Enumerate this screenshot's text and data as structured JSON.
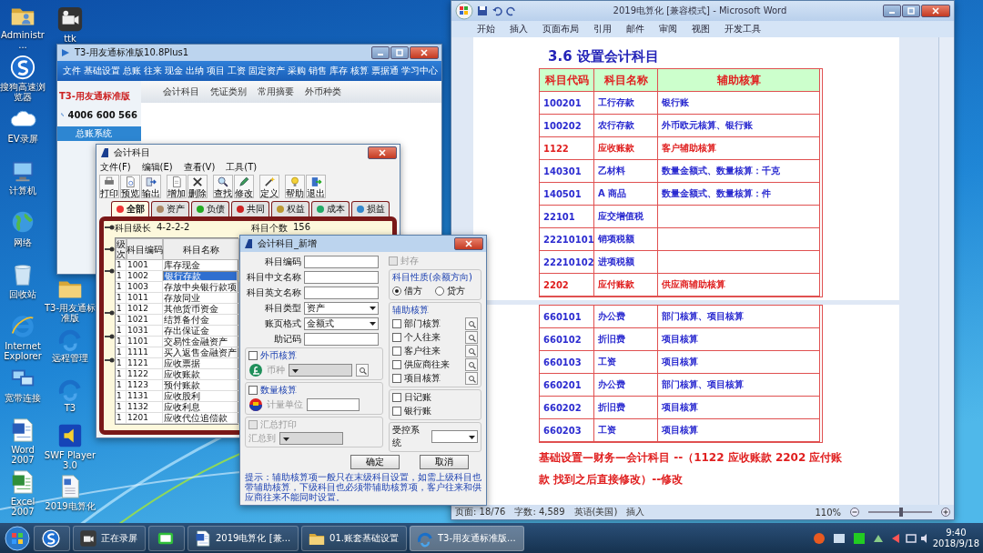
{
  "desktop": {
    "column_1": [
      {
        "kind": "user-folder",
        "label": "Administr..."
      },
      {
        "kind": "circle-app",
        "label": "搜狗高速浏览器"
      },
      {
        "kind": "cloud",
        "label": "EV录屏"
      },
      {
        "kind": "computer",
        "label": "计算机"
      },
      {
        "kind": "globe",
        "label": "网络"
      },
      {
        "kind": "trash",
        "label": "回收站"
      },
      {
        "kind": "browser",
        "label": "Internet Explorer"
      },
      {
        "kind": "monitor",
        "label": "宽带连接"
      },
      {
        "kind": "document",
        "label": "Word 2007"
      },
      {
        "kind": "spreadsheet",
        "label": "Excel 2007"
      }
    ],
    "column_2": [
      {
        "kind": "camera",
        "label": "ttk"
      },
      {
        "kind": "folder",
        "label": "T3-用友通标准版"
      },
      {
        "kind": "swirl",
        "label": "远程管理"
      },
      {
        "kind": "swirl",
        "label": "T3"
      },
      {
        "kind": "speaker",
        "label": "SWF Player 3.0"
      },
      {
        "kind": "file",
        "label": "2019电算化"
      }
    ]
  },
  "t3_window": {
    "title": "T3-用友通标准版10.8Plus1",
    "menu": [
      "文件",
      "基础设置",
      "总账",
      "往来",
      "现金",
      "出纳",
      "项目",
      "工资",
      "固定资产",
      "采购",
      "销售",
      "库存",
      "核算",
      "票据通",
      "学习中心"
    ],
    "logo": "T3-用友通标准版",
    "phone": "4006 600 566",
    "nav": [
      {
        "label": "总账系统",
        "selected": true
      }
    ],
    "toolbar_links": [
      "会计科目",
      "凭证类别",
      "常用摘要",
      "外币种类"
    ]
  },
  "accounts_window": {
    "title": "会计科目",
    "menu": [
      "文件(F)",
      "编辑(E)",
      "查看(V)",
      "工具(T)"
    ],
    "toolbar": [
      {
        "kind": "print",
        "label": "打印"
      },
      {
        "kind": "preview",
        "label": "预览"
      },
      {
        "kind": "export",
        "label": "输出"
      },
      {
        "kind": "add",
        "label": "增加"
      },
      {
        "kind": "delete",
        "label": "删除"
      },
      {
        "kind": "find",
        "label": "查找"
      },
      {
        "kind": "edit",
        "label": "修改"
      },
      {
        "kind": "define",
        "label": "定义"
      },
      {
        "kind": "help",
        "label": "帮助"
      },
      {
        "kind": "exit",
        "label": "退出"
      }
    ],
    "tabs": [
      {
        "label": "全部",
        "selected": true
      },
      {
        "label": "资产",
        "selected": false
      },
      {
        "label": "负债",
        "selected": false
      },
      {
        "label": "共同",
        "selected": false
      },
      {
        "label": "权益",
        "selected": false
      },
      {
        "label": "成本",
        "selected": false
      },
      {
        "label": "损益",
        "selected": false
      }
    ],
    "level_label": "科目级长",
    "level_value": "4-2-2-2",
    "count_label": "科目个数",
    "count_value": "156",
    "columns": [
      "级次",
      "科目编码",
      "科目名称"
    ],
    "rows": [
      {
        "level": "1",
        "code": "1001",
        "name": "库存现金",
        "selected": false
      },
      {
        "level": "1",
        "code": "1002",
        "name": "银行存款",
        "selected": true
      },
      {
        "level": "1",
        "code": "1003",
        "name": "存放中央银行款项",
        "selected": false
      },
      {
        "level": "1",
        "code": "1011",
        "name": "存放同业",
        "selected": false
      },
      {
        "level": "1",
        "code": "1012",
        "name": "其他货币资金",
        "selected": false
      },
      {
        "level": "1",
        "code": "1021",
        "name": "结算备付金",
        "selected": false
      },
      {
        "level": "1",
        "code": "1031",
        "name": "存出保证金",
        "selected": false
      },
      {
        "level": "1",
        "code": "1101",
        "name": "交易性金融资产",
        "selected": false
      },
      {
        "level": "1",
        "code": "1111",
        "name": "买入返售金融资产",
        "selected": false
      },
      {
        "level": "1",
        "code": "1121",
        "name": "应收票据",
        "selected": false
      },
      {
        "level": "1",
        "code": "1122",
        "name": "应收账款",
        "selected": false
      },
      {
        "level": "1",
        "code": "1123",
        "name": "预付账款",
        "selected": false
      },
      {
        "level": "1",
        "code": "1131",
        "name": "应收股利",
        "selected": false
      },
      {
        "level": "1",
        "code": "1132",
        "name": "应收利息",
        "selected": false
      },
      {
        "level": "1",
        "code": "1201",
        "name": "应收代位追偿款",
        "selected": false
      }
    ]
  },
  "new_account_dialog": {
    "title": "会计科目_新增",
    "fields": [
      {
        "label": "科目编码",
        "kind": "text"
      },
      {
        "label": "科目中文名称",
        "kind": "text"
      },
      {
        "label": "科目英文名称",
        "kind": "text"
      },
      {
        "label": "科目类型",
        "kind": "select",
        "value": "资产"
      },
      {
        "label": "账页格式",
        "kind": "select",
        "value": "金额式"
      },
      {
        "label": "助记码",
        "kind": "text"
      }
    ],
    "sealed": {
      "label": "封存",
      "checked": false,
      "disabled": true
    },
    "foreign_currency": {
      "label": "外币核算",
      "checked": false,
      "disabled": false,
      "field_label": "币种"
    },
    "quantity": {
      "label": "数量核算",
      "checked": false,
      "disabled": false,
      "field_label": "计量单位"
    },
    "summary_print": {
      "label": "汇总打印",
      "checked": false,
      "disabled": true,
      "field_label": "汇总到"
    },
    "balance_direction": {
      "title": "科目性质(余额方向)",
      "options": [
        {
          "label": "借方",
          "selected": true
        },
        {
          "label": "贷方",
          "selected": false
        }
      ]
    },
    "auxiliary": {
      "title": "辅助核算",
      "items": [
        {
          "label": "部门核算",
          "checked": false
        },
        {
          "label": "个人往来",
          "checked": false
        },
        {
          "label": "客户往来",
          "checked": false
        },
        {
          "label": "供应商往来",
          "checked": false
        },
        {
          "label": "项目核算",
          "checked": false
        }
      ]
    },
    "journals": [
      {
        "label": "日记账",
        "checked": false
      },
      {
        "label": "银行账",
        "checked": false
      }
    ],
    "controlled_system": {
      "label": "受控系统"
    },
    "buttons": [
      "确定",
      "取消"
    ],
    "hint": "提示：辅助核算项一般只在末级科目设置，如需上级科目也带辅助核算，下级科目也必须带辅助核算项，客户往来和供应商往来不能同时设置。"
  },
  "word_window": {
    "title": "2019电算化 [兼容模式] - Microsoft Word",
    "ribbon_tabs": [
      "开始",
      "插入",
      "页面布局",
      "引用",
      "邮件",
      "审阅",
      "视图",
      "开发工具"
    ],
    "heading": "3.6 设置会计科目",
    "table": {
      "columns": [
        "科目代码",
        "科目名称",
        "辅助核算"
      ],
      "rows": [
        {
          "code": "100201",
          "name": "工行存款",
          "auxiliary": "银行账",
          "color": "#2b2bd0"
        },
        {
          "code": "100202",
          "name": "农行存款",
          "auxiliary": "外币欧元核算、银行账",
          "color": "#2b2bd0"
        },
        {
          "code": "1122",
          "name": "应收账款",
          "auxiliary": "客户辅助核算",
          "color": "#e02020"
        },
        {
          "code": "140301",
          "name": "乙材料",
          "auxiliary": "数量金额式、数量核算：千克",
          "color": "#2b2bd0"
        },
        {
          "code": "140501",
          "name": "A 商品",
          "auxiliary": "数量金额式、数量核算：件",
          "color": "#2b2bd0"
        },
        {
          "code": "22101",
          "name": "应交增值税",
          "color": "#2b2bd0"
        },
        {
          "code": "22210101",
          "name": "销项税额",
          "color": "#2b2bd0"
        },
        {
          "code": "22210102",
          "name": "进项税额",
          "color": "#2b2bd0"
        },
        {
          "code": "2202",
          "name": "应付账款",
          "auxiliary": "供应商辅助核算",
          "color": "#e02020"
        }
      ]
    },
    "table_continued": {
      "rows": [
        {
          "code": "660101",
          "name": "办公费",
          "auxiliary": "部门核算、项目核算",
          "color": "#2b2bd0"
        },
        {
          "code": "660102",
          "name": "折旧费",
          "auxiliary": "项目核算",
          "color": "#2b2bd0"
        },
        {
          "code": "660103",
          "name": "工资",
          "auxiliary": "项目核算",
          "color": "#2b2bd0"
        },
        {
          "code": "660201",
          "name": "办公费",
          "auxiliary": "部门核算、项目核算",
          "color": "#2b2bd0"
        },
        {
          "code": "660202",
          "name": "折旧费",
          "auxiliary": "项目核算",
          "color": "#2b2bd0"
        },
        {
          "code": "660203",
          "name": "工资",
          "auxiliary": "项目核算",
          "color": "#2b2bd0"
        }
      ]
    },
    "note": "基础设置—财务—会计科目 --（1122 应收账款 2202 应付账款 找到之后直接修改）--修改",
    "status_bar": {
      "page": "页面: 18/76",
      "words": "字数: 4,589",
      "language": "英语(美国)",
      "mode": "插入",
      "zoom": "110%",
      "zoom_slider": {
        "level": 0.52
      }
    }
  },
  "taskbar": {
    "items": [
      {
        "kind": "recorder",
        "label": "正在录屏",
        "selected": false
      },
      {
        "kind": "tv",
        "selected": false
      },
      {
        "kind": "document",
        "label": "2019电算化 [兼...",
        "selected": false
      },
      {
        "kind": "folder",
        "label": "01.账套基础设置",
        "selected": false
      },
      {
        "kind": "swirl",
        "label": "T3-用友通标准版...",
        "selected": true
      }
    ],
    "time": "9:40",
    "date": "2018/9/18"
  }
}
